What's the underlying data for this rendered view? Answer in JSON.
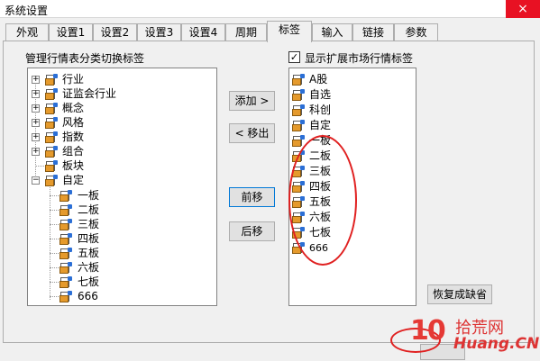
{
  "window": {
    "title": "系统设置",
    "close_glyph": "×"
  },
  "tabs": [
    {
      "label": "外观"
    },
    {
      "label": "设置1"
    },
    {
      "label": "设置2"
    },
    {
      "label": "设置3"
    },
    {
      "label": "设置4"
    },
    {
      "label": "周期"
    },
    {
      "label": "标签"
    },
    {
      "label": "输入"
    },
    {
      "label": "链接"
    },
    {
      "label": "参数"
    }
  ],
  "active_tab": "标签",
  "left": {
    "label": "管理行情表分类切换标签",
    "tree": [
      {
        "label": "行业",
        "expander": "+"
      },
      {
        "label": "证监会行业",
        "expander": "+"
      },
      {
        "label": "概念",
        "expander": "+"
      },
      {
        "label": "风格",
        "expander": "+"
      },
      {
        "label": "指数",
        "expander": "+"
      },
      {
        "label": "组合",
        "expander": "+"
      },
      {
        "label": "板块",
        "expander": ""
      },
      {
        "label": "自定",
        "expander": "−"
      },
      {
        "label": "一板"
      },
      {
        "label": "二板"
      },
      {
        "label": "三板"
      },
      {
        "label": "四板"
      },
      {
        "label": "五板"
      },
      {
        "label": "六板"
      },
      {
        "label": "七板"
      },
      {
        "label": "666"
      }
    ]
  },
  "right": {
    "checkbox_label": "显示扩展市场行情标签",
    "checked": true,
    "check_glyph": "✓",
    "items": [
      {
        "label": "A股"
      },
      {
        "label": "自选"
      },
      {
        "label": "科创"
      },
      {
        "label": "自定"
      },
      {
        "label": "一板"
      },
      {
        "label": "二板"
      },
      {
        "label": "三板"
      },
      {
        "label": "四板"
      },
      {
        "label": "五板"
      },
      {
        "label": "六板"
      },
      {
        "label": "七板"
      },
      {
        "label": "666"
      }
    ]
  },
  "buttons": {
    "add": "添加 >",
    "remove": "< 移出",
    "up": "前移",
    "down": "后移",
    "restore": "恢复成缺省"
  },
  "watermark": {
    "logo": "10",
    "cn": "拾荒网",
    "en": "Huang.CN"
  },
  "colors": {
    "close": "#e81123",
    "annotation": "#e02020",
    "folder": "#e59a2c",
    "tag": "#2b6fd6"
  }
}
